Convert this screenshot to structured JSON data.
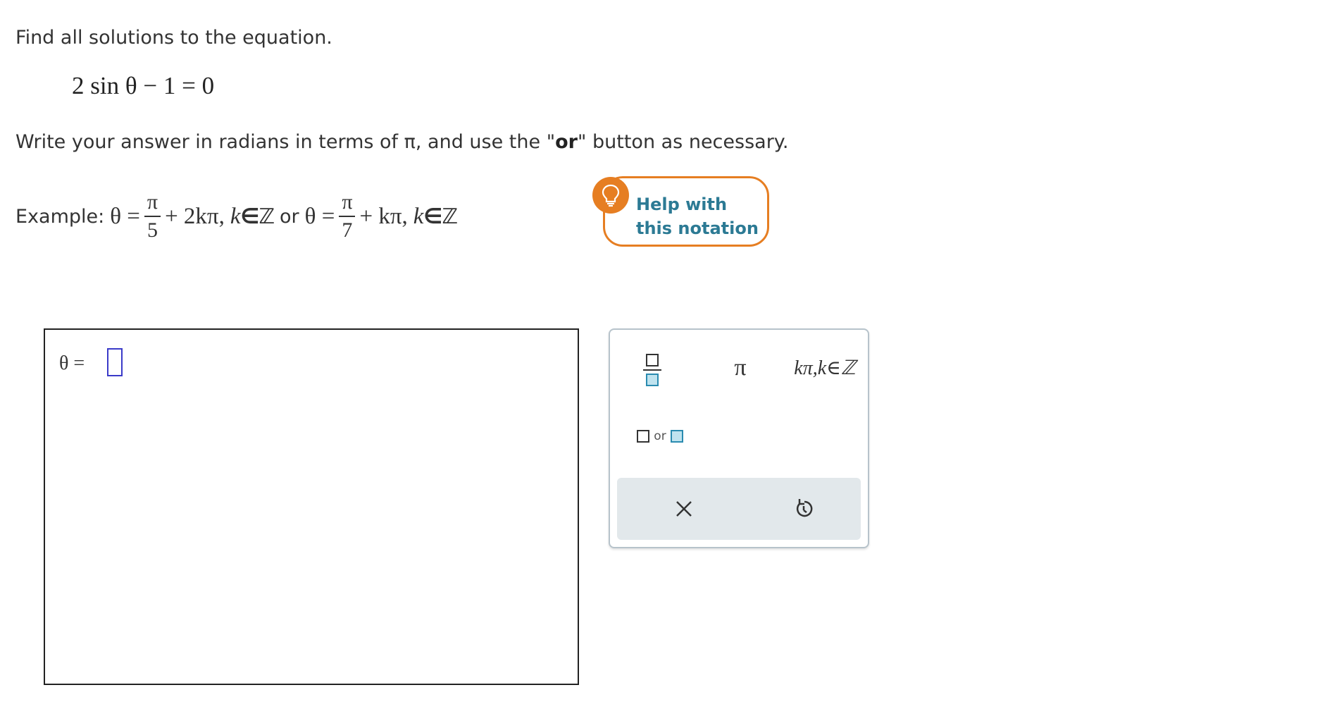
{
  "question": {
    "prompt": "Find all solutions to the equation.",
    "equation": "2 sin θ − 1 = 0",
    "instructions_before": "Write your answer in radians in terms of π, and use the \"",
    "instructions_bold": "or",
    "instructions_after": "\" button as necessary."
  },
  "example": {
    "label": "Example:",
    "first": {
      "theta_eq": "θ =",
      "numerator": "π",
      "denominator": "5",
      "term": "+ 2kπ,",
      "k": "k",
      "in_set": "∈ℤ"
    },
    "or_word": "or",
    "second": {
      "theta_eq": "θ =",
      "numerator": "π",
      "denominator": "7",
      "term": "+ kπ,",
      "k": "k",
      "in_set": "∈ℤ"
    }
  },
  "help": {
    "label": "Help with this notation",
    "icon": "lightbulb-icon",
    "accent_color": "#e67e22",
    "text_color": "#2c7a94"
  },
  "answer": {
    "label": "θ =",
    "value": "",
    "cursor_color": "#3a3ac8"
  },
  "palette": {
    "pi_symbol": "π",
    "kpi_label": "kπ,k∈ℤ",
    "or_label": "or",
    "fraction_icon": "fraction-template-icon",
    "clear_icon": "close-icon",
    "undo_icon": "undo-icon"
  }
}
